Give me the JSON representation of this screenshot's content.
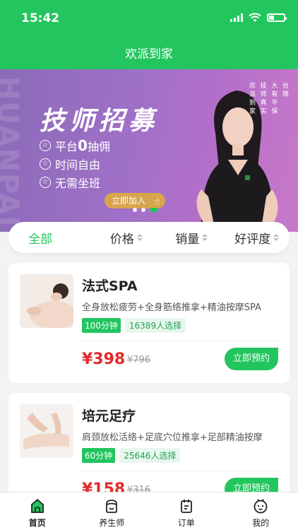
{
  "status_bar": {
    "time": "15:42",
    "battery_level": 0.35
  },
  "nav": {
    "title": "欢派到家"
  },
  "banner": {
    "ghost_text": "HUANPAI",
    "headline": "技师招募",
    "features": [
      {
        "prefix": "平台",
        "emphasis": "0",
        "suffix": "抽佣"
      },
      {
        "prefix": "时间自由",
        "emphasis": "",
        "suffix": ""
      },
      {
        "prefix": "无需坐班",
        "emphasis": "",
        "suffix": ""
      }
    ],
    "join_label": "立即加入",
    "side_text": [
      "欢派到家",
      "技师真实",
      "大有平保",
      "台障"
    ],
    "dots_count": 3,
    "active_dot": 2
  },
  "filter": {
    "tabs": [
      {
        "label": "全部",
        "active": true
      },
      {
        "label": "价格",
        "active": false
      },
      {
        "label": "销量",
        "active": false
      },
      {
        "label": "好评度",
        "active": false
      }
    ]
  },
  "services": [
    {
      "name": "法式SPA",
      "description": "全身放松疲劳+全身筋络推拿+精油按摩SPA",
      "duration": "100分钟",
      "popularity": "16389人选择",
      "price": "¥398",
      "original_price": "¥796",
      "book_label": "立即预约"
    },
    {
      "name": "培元足疗",
      "description": "肩颈放松活络+足底穴位推拿+足部精油按摩",
      "duration": "60分钟",
      "popularity": "25646人选择",
      "price": "¥158",
      "original_price": "¥316",
      "book_label": "立即预约"
    }
  ],
  "tabbar": {
    "items": [
      {
        "label": "首页",
        "icon": "home-icon",
        "active": true
      },
      {
        "label": "养生师",
        "icon": "therapist-icon",
        "active": false
      },
      {
        "label": "订单",
        "icon": "order-icon",
        "active": false
      },
      {
        "label": "我的",
        "icon": "profile-icon",
        "active": false
      }
    ]
  },
  "colors": {
    "primary": "#22c55e",
    "price": "#e22a2a",
    "banner_start": "#8b6bb8",
    "banner_end": "#c879c8",
    "join_button": "#d9a44e"
  }
}
